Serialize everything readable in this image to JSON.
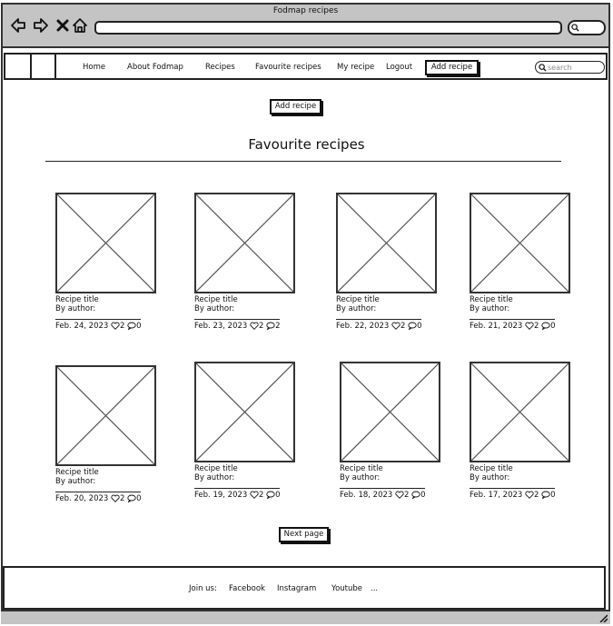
{
  "window": {
    "title": "Fodmap recipes"
  },
  "nav": {
    "home": "Home",
    "about": "About Fodmap",
    "recipes": "Recipes",
    "favourites": "Favourite recipes",
    "my_recipe": "My recipe",
    "logout": "Logout",
    "add_recipe": "Add recipe",
    "search_placeholder": "search"
  },
  "main": {
    "add_recipe_button": "Add recipe",
    "page_title": "Favourite recipes",
    "next_page": "Next page",
    "cards": [
      {
        "title": "Recipe title",
        "author": "By author:",
        "date": "Feb. 24, 2023",
        "likes": "2",
        "comments": "0"
      },
      {
        "title": "Recipe title",
        "author": "By author:",
        "date": "Feb. 23, 2023",
        "likes": "2",
        "comments": "2"
      },
      {
        "title": "Recipe title",
        "author": "By author:",
        "date": "Feb. 22, 2023",
        "likes": "2",
        "comments": "0"
      },
      {
        "title": "Recipe title",
        "author": "By author:",
        "date": "Feb. 21, 2023",
        "likes": "2",
        "comments": "0"
      },
      {
        "title": "Recipe title",
        "author": "By author:",
        "date": "Feb. 20, 2023",
        "likes": "2",
        "comments": "0"
      },
      {
        "title": "Recipe title",
        "author": "By author:",
        "date": "Feb. 19, 2023",
        "likes": "2",
        "comments": "0"
      },
      {
        "title": "Recipe title",
        "author": "By author:",
        "date": "Feb. 18, 2023",
        "likes": "2",
        "comments": "0"
      },
      {
        "title": "Recipe title",
        "author": "By author:",
        "date": "Feb. 17, 2023",
        "likes": "2",
        "comments": "0"
      }
    ]
  },
  "footer": {
    "join_us": "Join us:",
    "facebook": "Facebook",
    "instagram": "Instagram",
    "youtube": "Youtube",
    "more": "..."
  },
  "icons": {
    "back": "arrow-left-icon",
    "forward": "arrow-right-icon",
    "close": "close-icon",
    "home": "home-icon",
    "search": "search-icon",
    "like": "heart-icon",
    "comment": "comment-icon",
    "image_placeholder": "image-placeholder-icon"
  }
}
